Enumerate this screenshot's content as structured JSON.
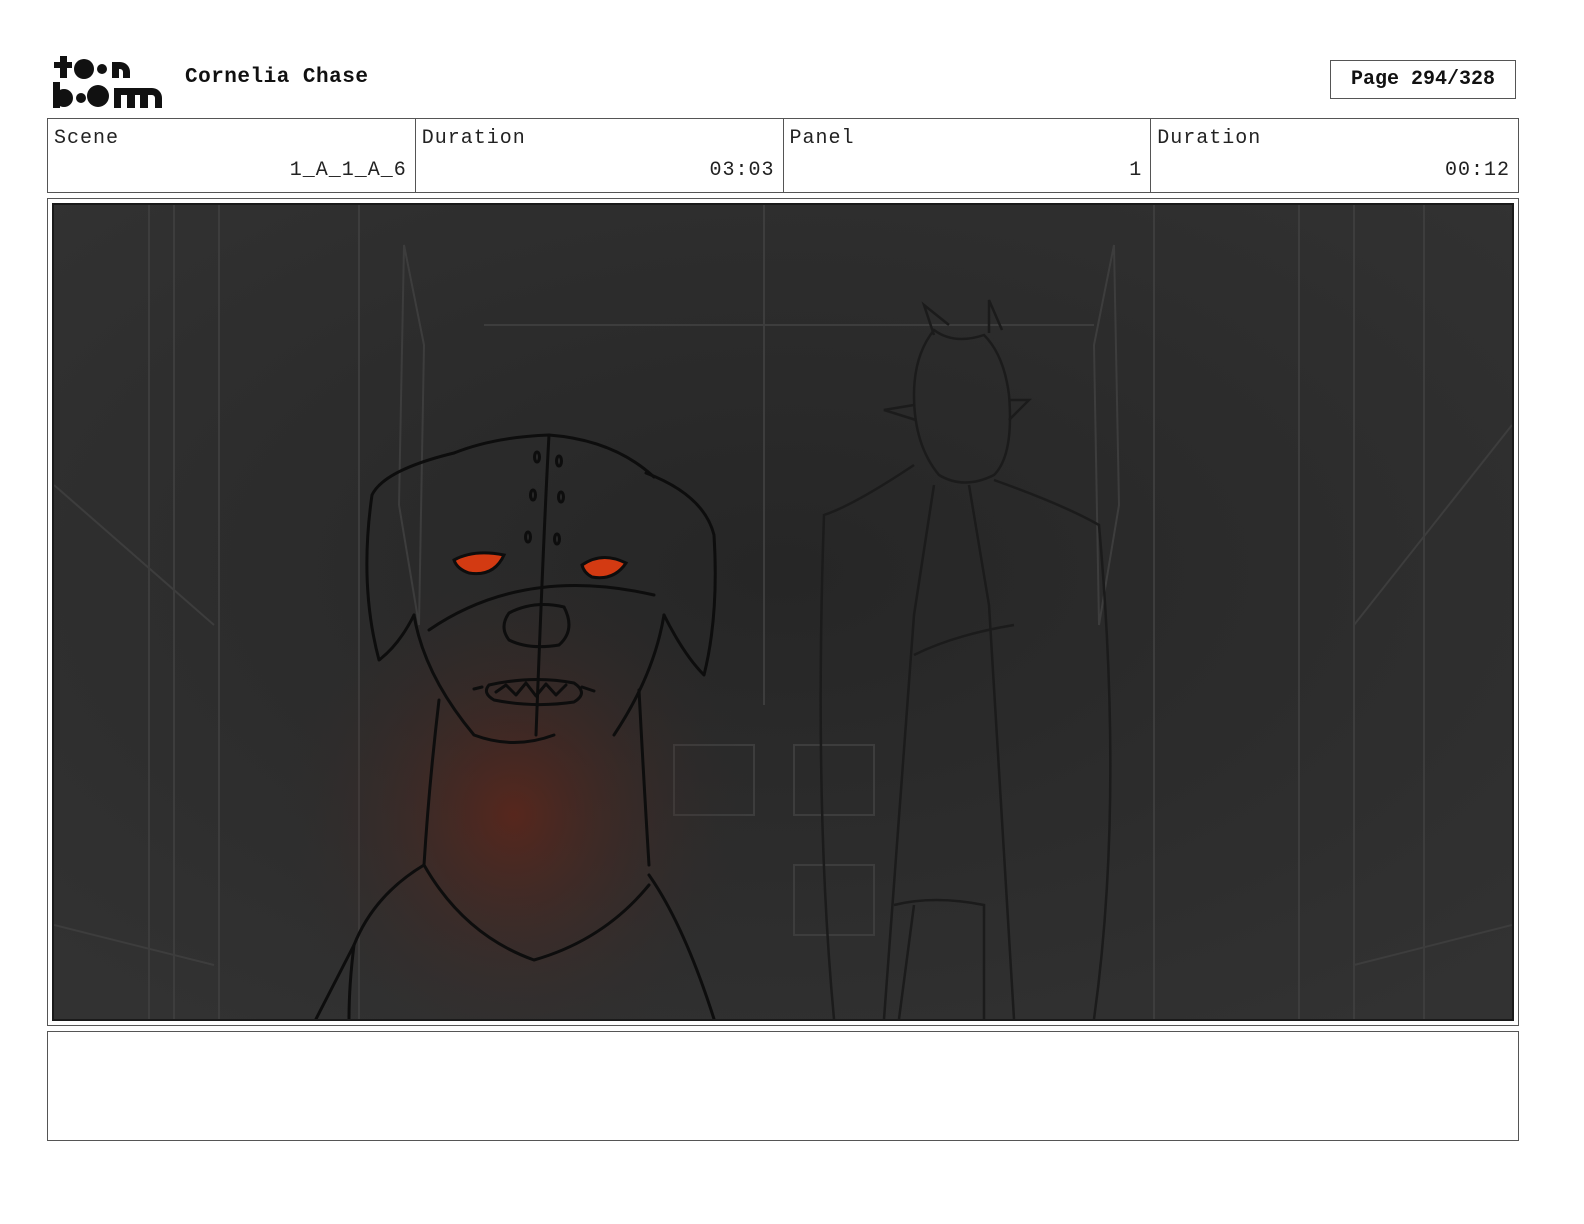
{
  "header": {
    "logo_text": "toonboom",
    "project_title": "Cornelia Chase",
    "page_label": "Page 294/328"
  },
  "info": {
    "scene_label": "Scene",
    "scene_value": "1_A_1_A_6",
    "scene_duration_label": "Duration",
    "scene_duration_value": "03:03",
    "panel_label": "Panel",
    "panel_value": "1",
    "panel_duration_label": "Duration",
    "panel_duration_value": "00:12"
  },
  "panel": {
    "background_color": "#2c2c2c",
    "eye_color": "#d33a12"
  },
  "notes": {
    "text": ""
  }
}
